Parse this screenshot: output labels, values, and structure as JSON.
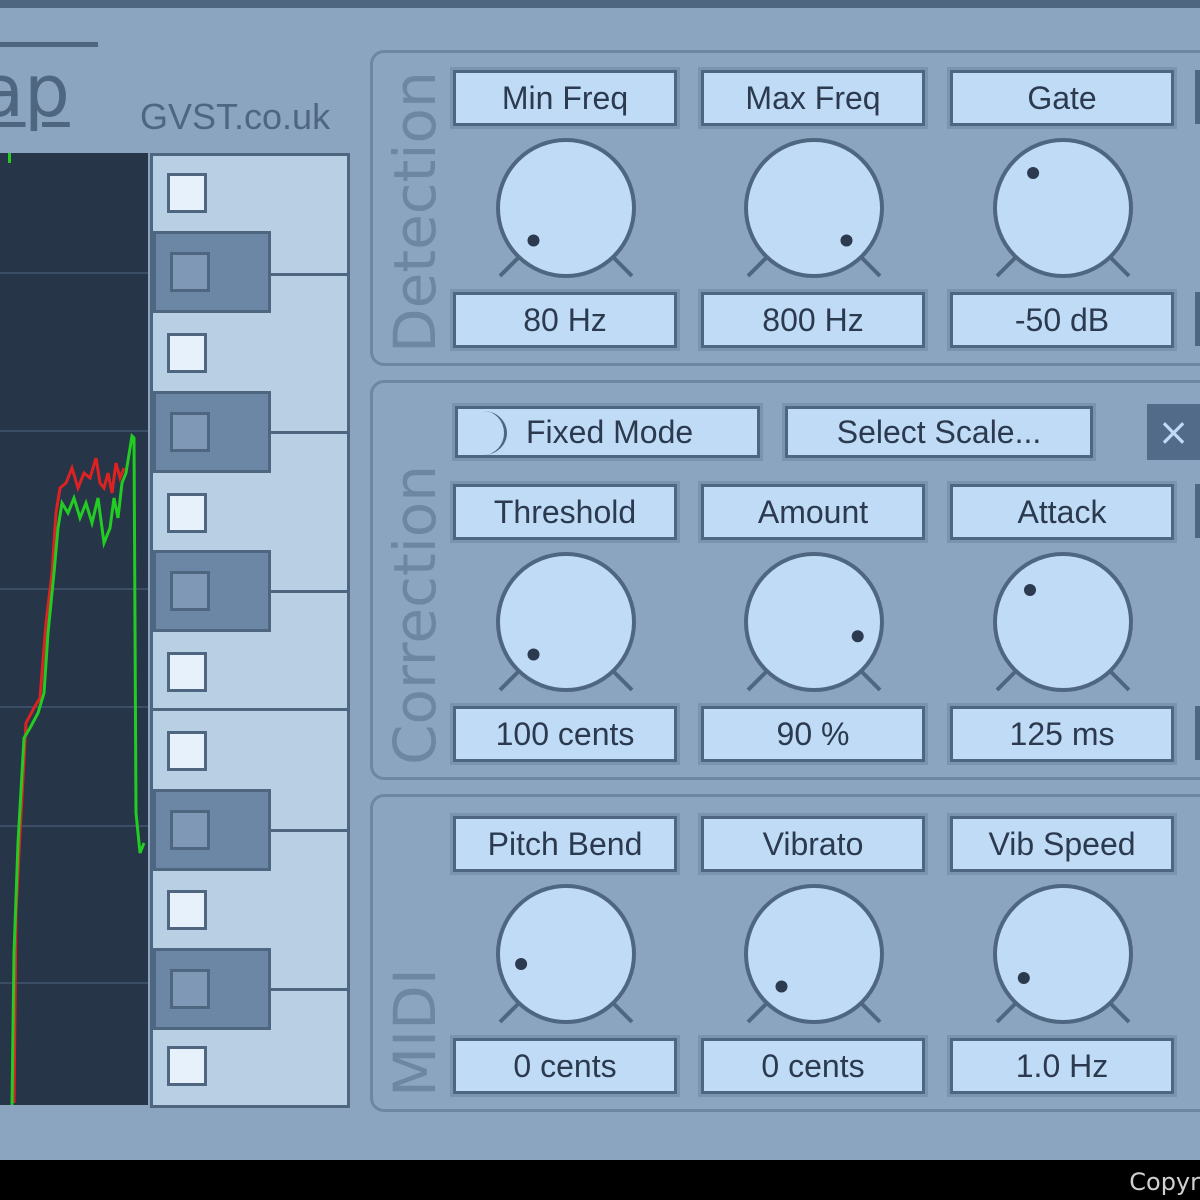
{
  "header": {
    "logo_text": "ap",
    "site": "GVST.co.uk"
  },
  "footer": {
    "text": "Copyr"
  },
  "panels": {
    "detection": {
      "title": "Detection",
      "controls": [
        {
          "name": "Min Freq",
          "value": "80 Hz",
          "level": 0.0
        },
        {
          "name": "Max Freq",
          "value": "800 Hz",
          "level": 1.0
        },
        {
          "name": "Gate",
          "value": "-50 dB",
          "level": 0.35
        }
      ]
    },
    "correction": {
      "title": "Correction",
      "fixed_mode_label": "Fixed Mode",
      "select_scale_label": "Select Scale...",
      "close_label": "×",
      "controls": [
        {
          "name": "Threshold",
          "value": "100 cents",
          "level": 0.0
        },
        {
          "name": "Amount",
          "value": "90 %",
          "level": 0.9
        },
        {
          "name": "Attack",
          "value": "125 ms",
          "level": 0.33
        }
      ]
    },
    "midi": {
      "title": "MIDI",
      "controls": [
        {
          "name": "Pitch Bend",
          "value": "0 cents",
          "level": 0.12
        },
        {
          "name": "Vibrato",
          "value": "0 cents",
          "level": 0.0
        },
        {
          "name": "Vib Speed",
          "value": "1.0 Hz",
          "level": 0.05
        }
      ]
    }
  },
  "colors": {
    "background": "#8ba4c0",
    "accent": "#4f6680",
    "control_fill": "#c0dbf6",
    "graph_bg": "#263547",
    "trace_green": "#22cc22",
    "trace_red": "#dd2222"
  }
}
